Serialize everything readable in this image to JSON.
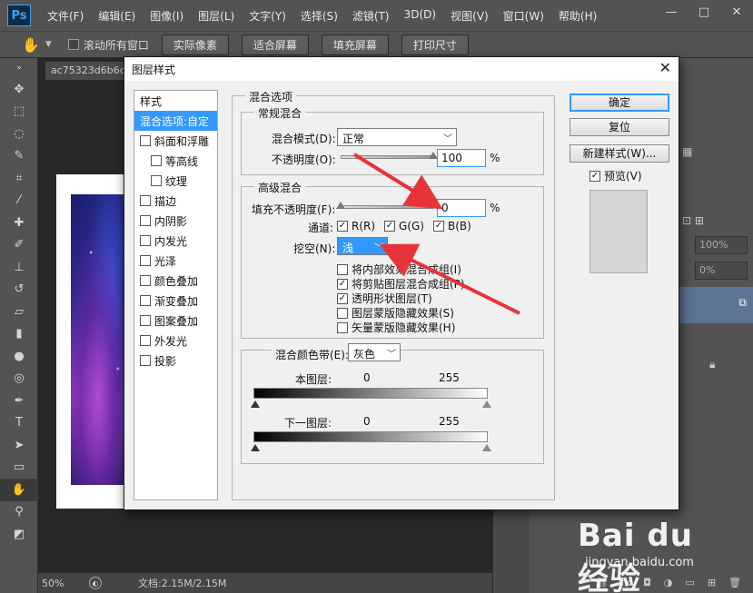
{
  "app": {
    "logo": "Ps",
    "menu": [
      "文件(F)",
      "编辑(E)",
      "图像(I)",
      "图层(L)",
      "文字(Y)",
      "选择(S)",
      "滤镜(T)",
      "3D(D)",
      "视图(V)",
      "窗口(W)",
      "帮助(H)"
    ],
    "window_controls": [
      "—",
      "□",
      "✕"
    ]
  },
  "options_bar": {
    "scroll_all_label": "滚动所有窗口",
    "buttons": [
      "实际像素",
      "适合屏幕",
      "填充屏幕",
      "打印尺寸"
    ]
  },
  "document": {
    "tab_title": "ac75323d6b6c",
    "zoom": "50%",
    "doc_info": "文档:2.15M/2.15M"
  },
  "right_panel": {
    "fields": [
      "100%",
      "0%"
    ]
  },
  "dialog": {
    "title": "图层样式",
    "style_list_header": "样式",
    "style_items": [
      {
        "label": "混合选项:自定",
        "selected": true,
        "checkbox": false,
        "indent": false
      },
      {
        "label": "斜面和浮雕",
        "selected": false,
        "checkbox": true,
        "indent": false
      },
      {
        "label": "等高线",
        "selected": false,
        "checkbox": true,
        "indent": true
      },
      {
        "label": "纹理",
        "selected": false,
        "checkbox": true,
        "indent": true
      },
      {
        "label": "描边",
        "selected": false,
        "checkbox": true,
        "indent": false
      },
      {
        "label": "内阴影",
        "selected": false,
        "checkbox": true,
        "indent": false
      },
      {
        "label": "内发光",
        "selected": false,
        "checkbox": true,
        "indent": false
      },
      {
        "label": "光泽",
        "selected": false,
        "checkbox": true,
        "indent": false
      },
      {
        "label": "颜色叠加",
        "selected": false,
        "checkbox": true,
        "indent": false
      },
      {
        "label": "渐变叠加",
        "selected": false,
        "checkbox": true,
        "indent": false
      },
      {
        "label": "图案叠加",
        "selected": false,
        "checkbox": true,
        "indent": false
      },
      {
        "label": "外发光",
        "selected": false,
        "checkbox": true,
        "indent": false
      },
      {
        "label": "投影",
        "selected": false,
        "checkbox": true,
        "indent": false
      }
    ],
    "blend_options": {
      "section_title": "混合选项",
      "general": {
        "title": "常规混合",
        "blend_mode_label": "混合模式(D):",
        "blend_mode_value": "正常",
        "opacity_label": "不透明度(O):",
        "opacity_value": "100",
        "opacity_fraction": 1.0,
        "percent": "%"
      },
      "advanced": {
        "title": "高级混合",
        "fill_opacity_label": "填充不透明度(F):",
        "fill_opacity_value": "0",
        "fill_opacity_fraction": 0.0,
        "percent": "%",
        "channels_label": "通道:",
        "channels": [
          {
            "label": "R(R)",
            "checked": true
          },
          {
            "label": "G(G)",
            "checked": true
          },
          {
            "label": "B(B)",
            "checked": true
          }
        ],
        "knockout_label": "挖空(N):",
        "knockout_value": "浅",
        "checkboxes": [
          {
            "label": "将内部效果混合成组(I)",
            "checked": false
          },
          {
            "label": "将剪贴图层混合成组(P)",
            "checked": true
          },
          {
            "label": "透明形状图层(T)",
            "checked": true
          },
          {
            "label": "图层蒙版隐藏效果(S)",
            "checked": false
          },
          {
            "label": "矢量蒙版隐藏效果(H)",
            "checked": false
          }
        ]
      },
      "blend_if": {
        "label": "混合颜色带(E):",
        "value": "灰色",
        "this_layer_label": "本图层:",
        "underlying_label": "下一图层:",
        "min": "0",
        "max": "255"
      }
    },
    "buttons": {
      "ok": "确定",
      "reset": "复位",
      "new_style": "新建样式(W)...",
      "preview_label": "预览(V)",
      "preview_checked": true
    }
  },
  "watermark": {
    "brand": "Bai du 经验",
    "site": "jingyan.baidu.com"
  },
  "colors": {
    "accent": "#3399ff",
    "arrow": "#e8333a",
    "ps_chrome": "#535353"
  }
}
